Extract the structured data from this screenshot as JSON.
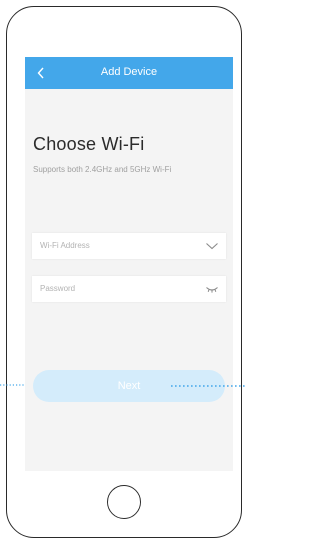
{
  "header": {
    "back_icon": "chevron-left-icon",
    "title": "Add Device"
  },
  "main": {
    "heading": "Choose Wi-Fi",
    "subheading": "Supports both 2.4GHz and 5GHz Wi-Fi"
  },
  "form": {
    "wifi_placeholder": "Wi-Fi Address",
    "wifi_icon": "chevron-down-icon",
    "password_placeholder": "Password",
    "password_icon": "eye-closed-icon"
  },
  "actions": {
    "next_label": "Next"
  },
  "colors": {
    "appbar": "#43a7ea",
    "screen_bg": "#f4f4f4",
    "next_button_disabled": "#d4ecfb",
    "annotation_dots": "#43a7ea"
  }
}
